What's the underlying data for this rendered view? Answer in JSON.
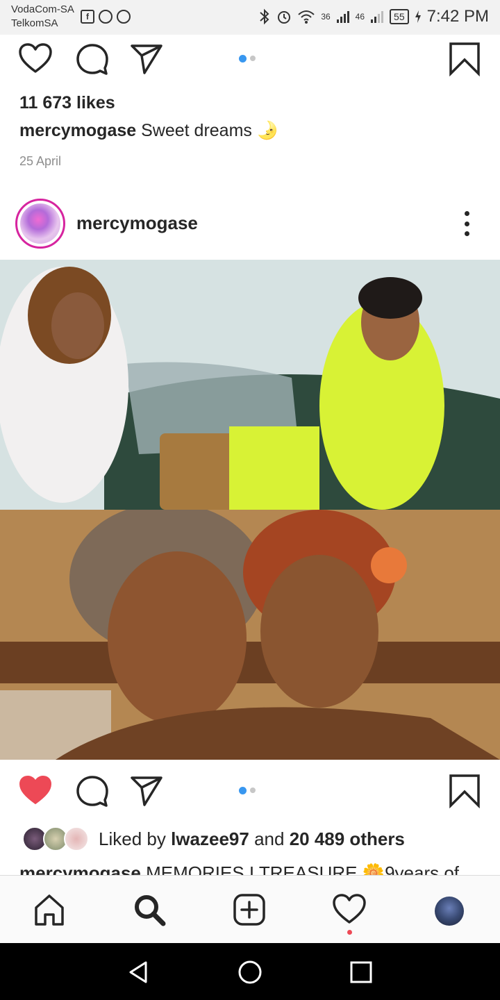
{
  "status_bar": {
    "carrier1": "VodaCom-SA",
    "carrier2": "TelkomSA",
    "sig1_label": "36",
    "sig2_label": "46",
    "battery": "55",
    "time": "7:42 PM"
  },
  "post1": {
    "likes": "11 673 likes",
    "caption_user": "mercymogase",
    "caption_text": "Sweet dreams 🌛",
    "date": "25 April"
  },
  "post2": {
    "username": "mercymogase",
    "liked_by_prefix": "Liked by",
    "liked_by_user": "lwazee97",
    "liked_by_and": "and",
    "liked_by_others": "20 489 others",
    "caption_user": "mercymogase",
    "caption_text": "MEMORIES I TREASURE 🌼9years of"
  },
  "colors": {
    "accent_blue": "#3897f0",
    "like_red": "#ed4956",
    "text": "#262626",
    "muted": "#8e8e8e"
  }
}
